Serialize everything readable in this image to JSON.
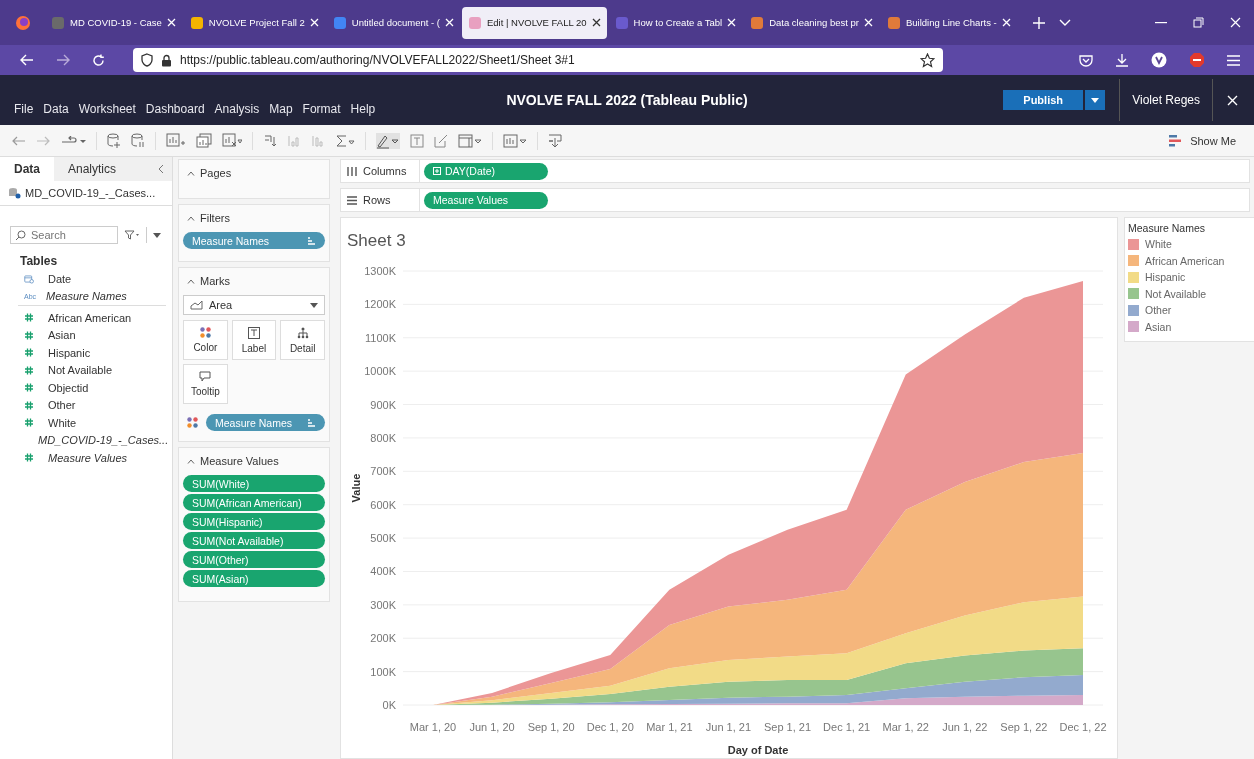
{
  "browser": {
    "tabs": [
      {
        "title": "MD COVID-19 - Case",
        "selected": false
      },
      {
        "title": "NVOLVE Project Fall 2",
        "selected": false
      },
      {
        "title": "Untitled document - (",
        "selected": false
      },
      {
        "title": "Edit | NVOLVE FALL 20",
        "selected": true
      },
      {
        "title": "How to Create a Tabl",
        "selected": false
      },
      {
        "title": "Data cleaning best pr",
        "selected": false
      },
      {
        "title": "Building Line Charts -",
        "selected": false
      }
    ],
    "url": "https://public.tableau.com/authoring/NVOLVEFALL2022/Sheet1/Sheet 3#1"
  },
  "app": {
    "menu": [
      "File",
      "Data",
      "Worksheet",
      "Dashboard",
      "Analysis",
      "Map",
      "Format",
      "Help"
    ],
    "title": "NVOLVE FALL 2022 (Tableau Public)",
    "publish": "Publish",
    "user": "Violet Reges",
    "show_me": "Show Me"
  },
  "data_pane": {
    "tabs": [
      {
        "label": "Data",
        "selected": true
      },
      {
        "label": "Analytics",
        "selected": false
      }
    ],
    "datasource": "MD_COVID-19_-_Cases...",
    "search": {
      "placeholder": "Search"
    },
    "tables_heading": "Tables",
    "fields": [
      {
        "kind": "date",
        "name": "Date",
        "italic": false
      },
      {
        "kind": "string",
        "badge": "Abc",
        "name": "Measure Names",
        "italic": true
      },
      {
        "kind": "number",
        "name": "African American",
        "italic": false
      },
      {
        "kind": "number",
        "name": "Asian",
        "italic": false
      },
      {
        "kind": "number",
        "name": "Hispanic",
        "italic": false
      },
      {
        "kind": "number",
        "name": "Not Available",
        "italic": false
      },
      {
        "kind": "number",
        "name": "Objectid",
        "italic": false
      },
      {
        "kind": "number",
        "name": "Other",
        "italic": false
      },
      {
        "kind": "number",
        "name": "White",
        "italic": false
      },
      {
        "kind": "number",
        "name": "MD_COVID-19_-_Cases...",
        "italic": true
      },
      {
        "kind": "number",
        "name": "Measure Values",
        "italic": true
      }
    ]
  },
  "cards": {
    "pages": "Pages",
    "filters": {
      "title": "Filters",
      "pills": [
        "Measure Names"
      ]
    },
    "marks": {
      "title": "Marks",
      "mark_type": "Area",
      "buttons": [
        {
          "kind": "color",
          "label": "Color"
        },
        {
          "kind": "label",
          "label": "Label"
        },
        {
          "kind": "detail",
          "label": "Detail"
        },
        {
          "kind": "tooltip",
          "label": "Tooltip"
        }
      ],
      "color_pill": "Measure Names"
    },
    "measure_values": {
      "title": "Measure Values",
      "pills": [
        "SUM(White)",
        "SUM(African American)",
        "SUM(Hispanic)",
        "SUM(Not Available)",
        "SUM(Other)",
        "SUM(Asian)"
      ]
    }
  },
  "shelves": [
    {
      "label": "Columns",
      "pill": "DAY(Date)"
    },
    {
      "label": "Rows",
      "pill": "Measure Values"
    }
  ],
  "sheet": {
    "title": "Sheet 3",
    "chart_data": {
      "type": "area",
      "stacked": true,
      "xlabel": "Day of Date",
      "ylabel": "Value",
      "categories": [
        "Mar 1, 20",
        "Jun 1, 20",
        "Sep 1, 20",
        "Dec 1, 20",
        "Mar 1, 21",
        "Jun 1, 21",
        "Sep 1, 21",
        "Dec 1, 21",
        "Mar 1, 22",
        "Jun 1, 22",
        "Sep 1, 22",
        "Dec 1, 22"
      ],
      "series": [
        {
          "name": "Asian",
          "color": "#d4a9c9",
          "values": [
            0,
            0,
            1,
            2,
            3,
            4,
            5,
            5,
            20,
            25,
            28,
            30
          ]
        },
        {
          "name": "Other",
          "color": "#93aace",
          "values": [
            0,
            1,
            3,
            6,
            12,
            18,
            20,
            25,
            30,
            45,
            55,
            60
          ]
        },
        {
          "name": "Not Available",
          "color": "#97c58e",
          "values": [
            0,
            6,
            15,
            25,
            40,
            48,
            50,
            45,
            75,
            78,
            80,
            80
          ]
        },
        {
          "name": "Hispanic",
          "color": "#f2db87",
          "values": [
            0,
            7,
            17,
            25,
            55,
            65,
            70,
            80,
            90,
            120,
            145,
            155
          ]
        },
        {
          "name": "African American",
          "color": "#f5b67c",
          "values": [
            0,
            11,
            30,
            50,
            130,
            160,
            170,
            190,
            370,
            400,
            420,
            430
          ]
        },
        {
          "name": "White",
          "color": "#eb9696",
          "values": [
            0,
            11,
            30,
            42,
            105,
            155,
            210,
            240,
            405,
            442,
            492,
            515
          ]
        }
      ],
      "ylim": [
        0,
        1300
      ],
      "grid": true,
      "yticks": [
        {
          "value": 0,
          "label": "0K"
        },
        {
          "value": 100,
          "label": "100K"
        },
        {
          "value": 200,
          "label": "200K"
        },
        {
          "value": 300,
          "label": "300K"
        },
        {
          "value": 400,
          "label": "400K"
        },
        {
          "value": 500,
          "label": "500K"
        },
        {
          "value": 600,
          "label": "600K"
        },
        {
          "value": 700,
          "label": "700K"
        },
        {
          "value": 800,
          "label": "800K"
        },
        {
          "value": 900,
          "label": "900K"
        },
        {
          "value": 1000,
          "label": "1000K"
        },
        {
          "value": 1100,
          "label": "1100K"
        },
        {
          "value": 1200,
          "label": "1200K"
        },
        {
          "value": 1300,
          "label": "1300K"
        }
      ]
    },
    "legend": {
      "title": "Measure Names"
    }
  }
}
